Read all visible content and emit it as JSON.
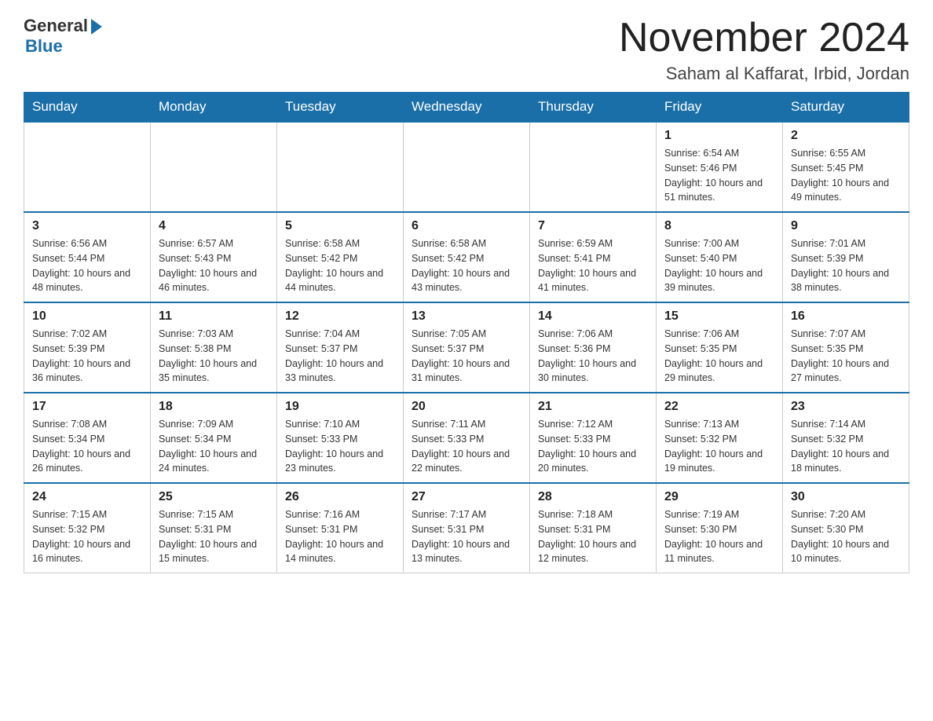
{
  "header": {
    "logo_general": "General",
    "logo_blue": "Blue",
    "month_title": "November 2024",
    "location": "Saham al Kaffarat, Irbid, Jordan"
  },
  "weekdays": [
    "Sunday",
    "Monday",
    "Tuesday",
    "Wednesday",
    "Thursday",
    "Friday",
    "Saturday"
  ],
  "weeks": [
    [
      {
        "day": "",
        "info": ""
      },
      {
        "day": "",
        "info": ""
      },
      {
        "day": "",
        "info": ""
      },
      {
        "day": "",
        "info": ""
      },
      {
        "day": "",
        "info": ""
      },
      {
        "day": "1",
        "info": "Sunrise: 6:54 AM\nSunset: 5:46 PM\nDaylight: 10 hours and 51 minutes."
      },
      {
        "day": "2",
        "info": "Sunrise: 6:55 AM\nSunset: 5:45 PM\nDaylight: 10 hours and 49 minutes."
      }
    ],
    [
      {
        "day": "3",
        "info": "Sunrise: 6:56 AM\nSunset: 5:44 PM\nDaylight: 10 hours and 48 minutes."
      },
      {
        "day": "4",
        "info": "Sunrise: 6:57 AM\nSunset: 5:43 PM\nDaylight: 10 hours and 46 minutes."
      },
      {
        "day": "5",
        "info": "Sunrise: 6:58 AM\nSunset: 5:42 PM\nDaylight: 10 hours and 44 minutes."
      },
      {
        "day": "6",
        "info": "Sunrise: 6:58 AM\nSunset: 5:42 PM\nDaylight: 10 hours and 43 minutes."
      },
      {
        "day": "7",
        "info": "Sunrise: 6:59 AM\nSunset: 5:41 PM\nDaylight: 10 hours and 41 minutes."
      },
      {
        "day": "8",
        "info": "Sunrise: 7:00 AM\nSunset: 5:40 PM\nDaylight: 10 hours and 39 minutes."
      },
      {
        "day": "9",
        "info": "Sunrise: 7:01 AM\nSunset: 5:39 PM\nDaylight: 10 hours and 38 minutes."
      }
    ],
    [
      {
        "day": "10",
        "info": "Sunrise: 7:02 AM\nSunset: 5:39 PM\nDaylight: 10 hours and 36 minutes."
      },
      {
        "day": "11",
        "info": "Sunrise: 7:03 AM\nSunset: 5:38 PM\nDaylight: 10 hours and 35 minutes."
      },
      {
        "day": "12",
        "info": "Sunrise: 7:04 AM\nSunset: 5:37 PM\nDaylight: 10 hours and 33 minutes."
      },
      {
        "day": "13",
        "info": "Sunrise: 7:05 AM\nSunset: 5:37 PM\nDaylight: 10 hours and 31 minutes."
      },
      {
        "day": "14",
        "info": "Sunrise: 7:06 AM\nSunset: 5:36 PM\nDaylight: 10 hours and 30 minutes."
      },
      {
        "day": "15",
        "info": "Sunrise: 7:06 AM\nSunset: 5:35 PM\nDaylight: 10 hours and 29 minutes."
      },
      {
        "day": "16",
        "info": "Sunrise: 7:07 AM\nSunset: 5:35 PM\nDaylight: 10 hours and 27 minutes."
      }
    ],
    [
      {
        "day": "17",
        "info": "Sunrise: 7:08 AM\nSunset: 5:34 PM\nDaylight: 10 hours and 26 minutes."
      },
      {
        "day": "18",
        "info": "Sunrise: 7:09 AM\nSunset: 5:34 PM\nDaylight: 10 hours and 24 minutes."
      },
      {
        "day": "19",
        "info": "Sunrise: 7:10 AM\nSunset: 5:33 PM\nDaylight: 10 hours and 23 minutes."
      },
      {
        "day": "20",
        "info": "Sunrise: 7:11 AM\nSunset: 5:33 PM\nDaylight: 10 hours and 22 minutes."
      },
      {
        "day": "21",
        "info": "Sunrise: 7:12 AM\nSunset: 5:33 PM\nDaylight: 10 hours and 20 minutes."
      },
      {
        "day": "22",
        "info": "Sunrise: 7:13 AM\nSunset: 5:32 PM\nDaylight: 10 hours and 19 minutes."
      },
      {
        "day": "23",
        "info": "Sunrise: 7:14 AM\nSunset: 5:32 PM\nDaylight: 10 hours and 18 minutes."
      }
    ],
    [
      {
        "day": "24",
        "info": "Sunrise: 7:15 AM\nSunset: 5:32 PM\nDaylight: 10 hours and 16 minutes."
      },
      {
        "day": "25",
        "info": "Sunrise: 7:15 AM\nSunset: 5:31 PM\nDaylight: 10 hours and 15 minutes."
      },
      {
        "day": "26",
        "info": "Sunrise: 7:16 AM\nSunset: 5:31 PM\nDaylight: 10 hours and 14 minutes."
      },
      {
        "day": "27",
        "info": "Sunrise: 7:17 AM\nSunset: 5:31 PM\nDaylight: 10 hours and 13 minutes."
      },
      {
        "day": "28",
        "info": "Sunrise: 7:18 AM\nSunset: 5:31 PM\nDaylight: 10 hours and 12 minutes."
      },
      {
        "day": "29",
        "info": "Sunrise: 7:19 AM\nSunset: 5:30 PM\nDaylight: 10 hours and 11 minutes."
      },
      {
        "day": "30",
        "info": "Sunrise: 7:20 AM\nSunset: 5:30 PM\nDaylight: 10 hours and 10 minutes."
      }
    ]
  ]
}
